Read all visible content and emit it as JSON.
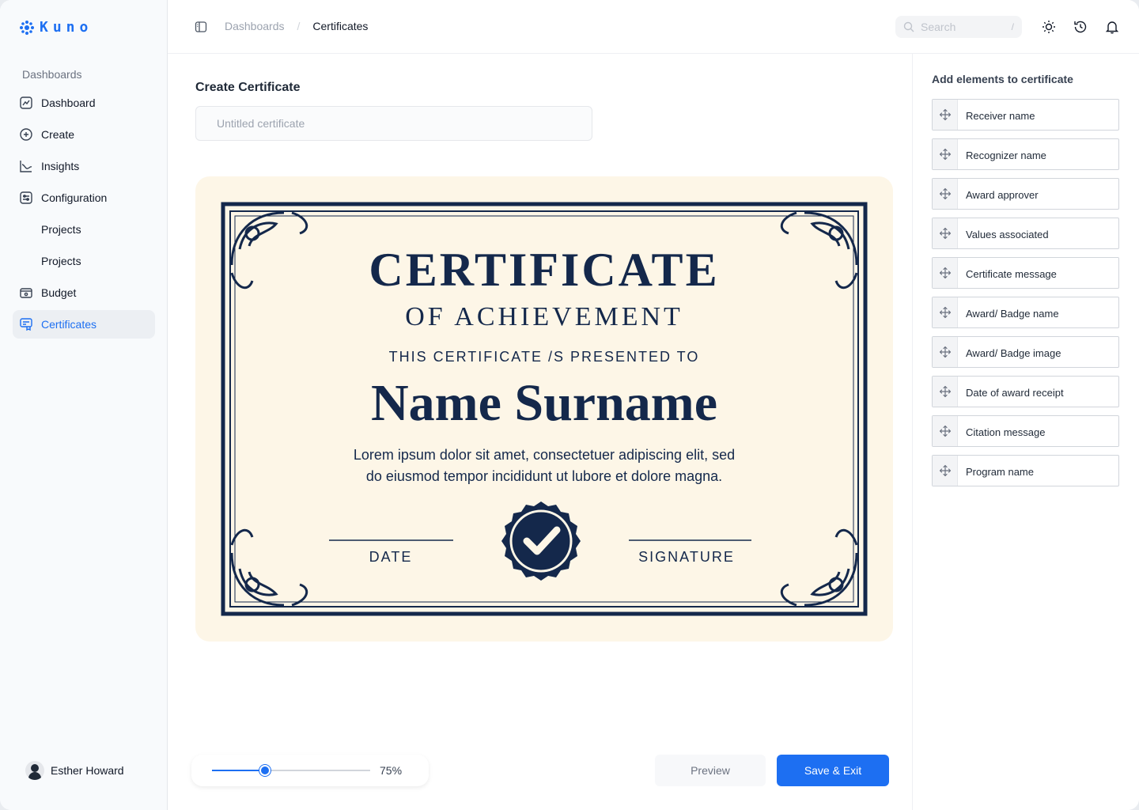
{
  "app": {
    "logo_text": "Kuno"
  },
  "sidebar": {
    "section_label": "Dashboards",
    "items": [
      {
        "label": "Dashboard",
        "icon": "dashboard-icon"
      },
      {
        "label": "Create",
        "icon": "plus-circle-icon"
      },
      {
        "label": "Insights",
        "icon": "chart-line-icon"
      },
      {
        "label": "Configuration",
        "icon": "sliders-icon"
      },
      {
        "label": "Projects",
        "icon": null
      },
      {
        "label": "Projects",
        "icon": null
      },
      {
        "label": "Budget",
        "icon": "wallet-icon"
      },
      {
        "label": "Certificates",
        "icon": "certificate-icon",
        "active": true
      }
    ],
    "user": {
      "name": "Esther Howard"
    }
  },
  "topbar": {
    "breadcrumb": {
      "parent": "Dashboards",
      "separator": "/",
      "current": "Certificates"
    },
    "search": {
      "placeholder": "Search",
      "shortcut": "/"
    },
    "icons": [
      "sun-icon",
      "history-icon",
      "bell-icon"
    ]
  },
  "main": {
    "title": "Create Certificate",
    "name_input": {
      "value": "",
      "placeholder": "Untitled certificate"
    },
    "certificate": {
      "heading": "CERTIFICATE",
      "subheading": "OF ACHIEVEMENT",
      "presented": "THIS CERTIFICATE /S PRESENTED TO",
      "recipient": "Name Surname",
      "body_line1": "Lorem ipsum dolor sit amet, consectetuer adipiscing elit, sed",
      "body_line2": "do eiusmod tempor incididunt ut lubore et dolore magna.",
      "date_label": "DATE",
      "signature_label": "SIGNATURE"
    },
    "zoom": {
      "percent": 75,
      "label": "75%"
    },
    "preview_label": "Preview",
    "save_label": "Save & Exit"
  },
  "right_panel": {
    "title": "Add elements to certificate",
    "elements": [
      "Receiver name",
      "Recognizer name",
      "Award approver",
      "Values associated",
      "Certificate message",
      "Award/ Badge name",
      "Award/ Badge image",
      "Date of award receipt",
      "Citation message",
      "Program name"
    ]
  },
  "colors": {
    "accent": "#1d6ff2",
    "navy": "#14284b",
    "parchment": "#fdf6e7"
  }
}
